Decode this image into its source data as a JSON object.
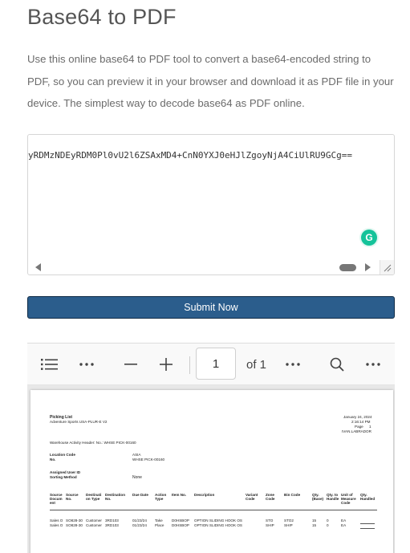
{
  "page": {
    "title": "Base64 to PDF",
    "description": "Use this online base64 to PDF tool to convert a base64-encoded string to PDF, so you can preview it in your browser and download it as PDF file in your device. The simplest way to decode base64 as PDF online."
  },
  "input": {
    "value": "yRDMzNDEyRDM0Pl0vU2l6ZSAxMD4+CnN0YXJ0eHJlZgoyNjA4CiUlRU9GCg=="
  },
  "submit": {
    "label": "Submit Now"
  },
  "viewer": {
    "current_page": "1",
    "page_count_label": "of 1"
  },
  "document": {
    "title": "Picking List",
    "company": "Adventure Sports USA-PLUR-E V2",
    "date": "January 24, 2024",
    "time": "2:16:14 PM",
    "page_label": "Page",
    "page_number": "1",
    "user": "IVAN.LABRADOR",
    "warehouse_header": "Warehouse Activity Header: No.: WHSE PICK-00160",
    "location_code_label": "Location Code",
    "location_code": "ASIA",
    "no_label": "No.",
    "no_value": "WHSE PICK-00160",
    "assigned_user_label": "Assigned User ID",
    "sorting_label": "Sorting Method",
    "sorting_value": "None",
    "columns": [
      "Source Docum ent",
      "Source No.",
      "Destinati on Type",
      "Destination No.",
      "Due Date",
      "Action Type",
      "Item No.",
      "Description",
      "Variant Code",
      "Zone Code",
      "Bin Code",
      "Qty. (Base)",
      "Qty. to Handle",
      "Unit of Measure Code",
      "Qty. Handled"
    ],
    "rows": [
      [
        "Sales O",
        "SO828-30",
        "Customer",
        "3RD103",
        "01/23/24",
        "Take",
        "D0HSBOP",
        "OPTION SLIDING HOOK OS",
        "",
        "STO",
        "STO2",
        "15",
        "0",
        "EA",
        ""
      ],
      [
        "Sales O",
        "SO828-30",
        "Customer",
        "3RD103",
        "01/23/24",
        "Place",
        "D0HSBOP",
        "OPTION SLIDING HOOK OS",
        "",
        "SHIP",
        "SHIP",
        "15",
        "0",
        "EA",
        ""
      ]
    ]
  },
  "colors": {
    "submit_bg": "#2b5d8c",
    "grammarly": "#15c39a"
  }
}
